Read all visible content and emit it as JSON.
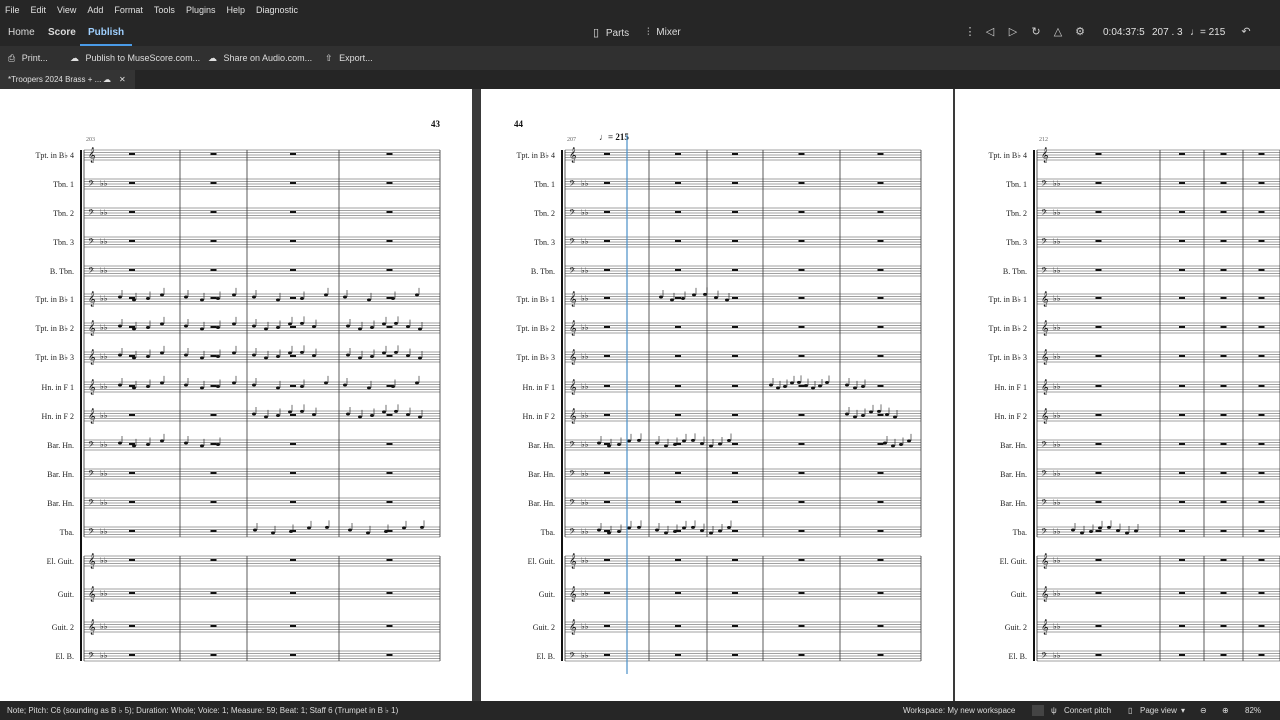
{
  "menu": [
    "File",
    "Edit",
    "View",
    "Add",
    "Format",
    "Tools",
    "Plugins",
    "Help",
    "Diagnostic"
  ],
  "tabs": {
    "home": "Home",
    "score": "Score",
    "publish": "Publish"
  },
  "center": {
    "parts": "Parts",
    "mixer": "Mixer"
  },
  "readout": {
    "time": "0:04:37:5",
    "position": "207 . 3",
    "tempo": "= 215"
  },
  "toolbar": {
    "print": "Print...",
    "publish_musescore": "Publish to MuseScore.com...",
    "share_audio": "Share on Audio.com...",
    "export": "Export..."
  },
  "doc_tab": {
    "title": "*Troopers 2024 Brass + ..."
  },
  "pages": [
    {
      "number": "43",
      "measure_start": "203"
    },
    {
      "number": "44",
      "measure_start": "207",
      "tempo_mark": "= 215"
    },
    {
      "measure_start": "212"
    }
  ],
  "instruments": [
    "Tpt. in B♭ 4",
    "Tbn. 1",
    "Tbn. 2",
    "Tbn. 3",
    "B. Tbn.",
    "Tpt. in B♭ 1",
    "Tpt. in B♭ 2",
    "Tpt. in B♭ 3",
    "Hn. in F 1",
    "Hn. in F 2",
    "Bar. Hn.",
    "Bar. Hn.",
    "Bar. Hn.",
    "Tba.",
    "El. Guit.",
    "Guit.",
    "Guit. 2",
    "El. B."
  ],
  "status": {
    "selection": "Note; Pitch: C6 (sounding as B ♭ 5); Duration: Whole; Voice: 1; Measure: 59; Beat: 1; Staff 6 (Trumpet in B ♭ 1)",
    "workspace": "Workspace: My new workspace",
    "concert_pitch": "Concert pitch",
    "view_mode": "Page view",
    "zoom": "82%"
  }
}
